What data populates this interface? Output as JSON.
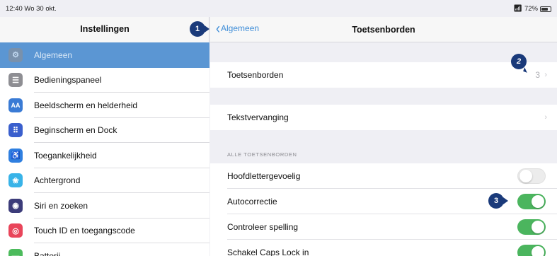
{
  "statusbar": {
    "time": "12:40 Wo 30 okt.",
    "battery": "72%",
    "battery_level": 0.72
  },
  "sidebar": {
    "title": "Instellingen",
    "items": [
      {
        "label": "Algemeen",
        "icon": "gear-icon",
        "color": "#8e8e93",
        "glyph": "⚙",
        "selected": true
      },
      {
        "label": "Bedieningspaneel",
        "icon": "control-center-icon",
        "color": "#8e8e93",
        "glyph": "☰"
      },
      {
        "label": "Beeldscherm en helderheid",
        "icon": "display-brightness-icon",
        "color": "#3a7bd5",
        "glyph": "AA"
      },
      {
        "label": "Beginscherm en Dock",
        "icon": "home-screen-icon",
        "color": "#3a5fcd",
        "glyph": "⠿"
      },
      {
        "label": "Toegankelijkheid",
        "icon": "accessibility-icon",
        "color": "#2f7fe0",
        "glyph": "♿"
      },
      {
        "label": "Achtergrond",
        "icon": "wallpaper-icon",
        "color": "#38b3e8",
        "glyph": "❀"
      },
      {
        "label": "Siri en zoeken",
        "icon": "siri-icon",
        "color": "#3c3c7a",
        "glyph": "◉"
      },
      {
        "label": "Touch ID en toegangscode",
        "icon": "fingerprint-icon",
        "color": "#e9455a",
        "glyph": "◎"
      },
      {
        "label": "Batterij",
        "icon": "battery-icon",
        "color": "#4cbb5c",
        "glyph": "▬"
      }
    ]
  },
  "navbar": {
    "back_label": "Algemeen",
    "title": "Toetsenborden"
  },
  "rows": {
    "keyboards": {
      "label": "Toetsenborden",
      "value": "3"
    },
    "text_replacement": {
      "label": "Tekstvervanging"
    }
  },
  "section_header": "ALLE TOETSENBORDEN",
  "toggles": [
    {
      "label": "Hoofdlettergevoelig",
      "on": false
    },
    {
      "label": "Autocorrectie",
      "on": true
    },
    {
      "label": "Controleer spelling",
      "on": true
    },
    {
      "label": "Schakel Caps Lock in",
      "on": true
    }
  ],
  "callouts": [
    "1",
    "2",
    "3"
  ],
  "colors": {
    "accent": "#3f8ed8",
    "toggle_on": "#4bb55e",
    "selected_row": "#5b96d3",
    "callout": "#1a3a7a"
  }
}
